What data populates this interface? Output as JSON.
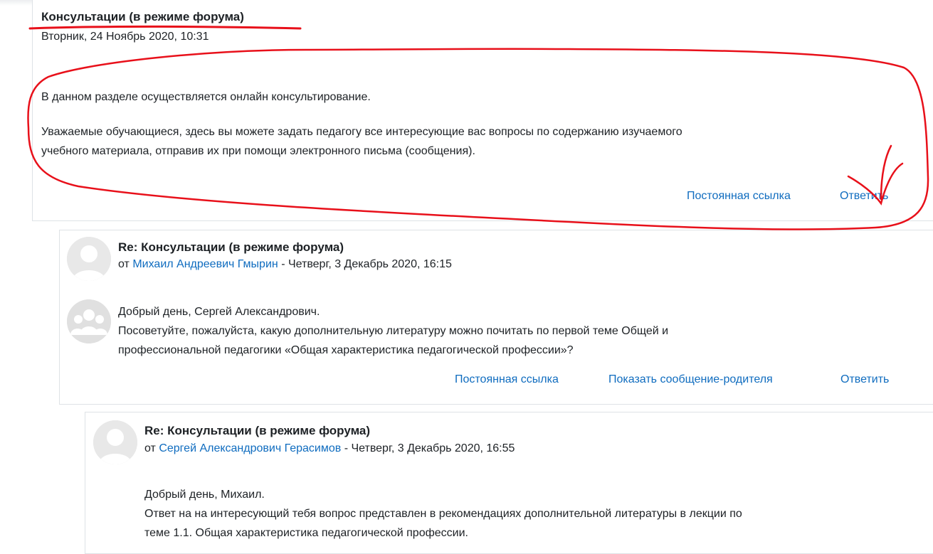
{
  "main_post": {
    "subject": "Консультации (в режиме форума)",
    "date": "Вторник, 24 Ноябрь 2020, 10:31",
    "paragraph1": "В данном разделе осуществляется онлайн консультирование.",
    "paragraph2_line1": "Уважаемые обучающиеся, здесь вы можете задать педагогу все интересующие вас вопросы по содержанию изучаемого",
    "paragraph2_line2": "учебного материала, отправив их при помощи электронного письма (сообщения).",
    "permalink": "Постоянная ссылка",
    "reply": "Ответить"
  },
  "reply1": {
    "subject": "Re: Консультации (в режиме форума)",
    "by": "от",
    "author": "Михаил Андреевич Гмырин",
    "date": "- Четверг, 3 Декабрь 2020, 16:15",
    "line1": "Добрый день, Сергей Александрович.",
    "line2": "Посоветуйте, пожалуйста, какую дополнительную литературу можно почитать по первой теме Общей и",
    "line3": "профессиональной педагогики «Общая характеристика педагогической профессии»?",
    "permalink": "Постоянная ссылка",
    "show_parent": "Показать сообщение-родителя",
    "reply": "Ответить"
  },
  "reply2": {
    "subject": "Re: Консультации (в режиме форума)",
    "by": "от",
    "author": "Сергей Александрович Герасимов",
    "date": "- Четверг, 3 Декабрь 2020, 16:55",
    "line1": "Добрый день, Михаил.",
    "line2": "Ответ на на интересующий тебя вопрос представлен в рекомендациях дополнительной литературы в лекции по",
    "line3": "теме 1.1. Общая характеристика педагогической профессии."
  },
  "colors": {
    "link": "#0f6cbf",
    "text": "#1d2125",
    "annotation": "#e8101a",
    "border": "#dee2e6"
  }
}
